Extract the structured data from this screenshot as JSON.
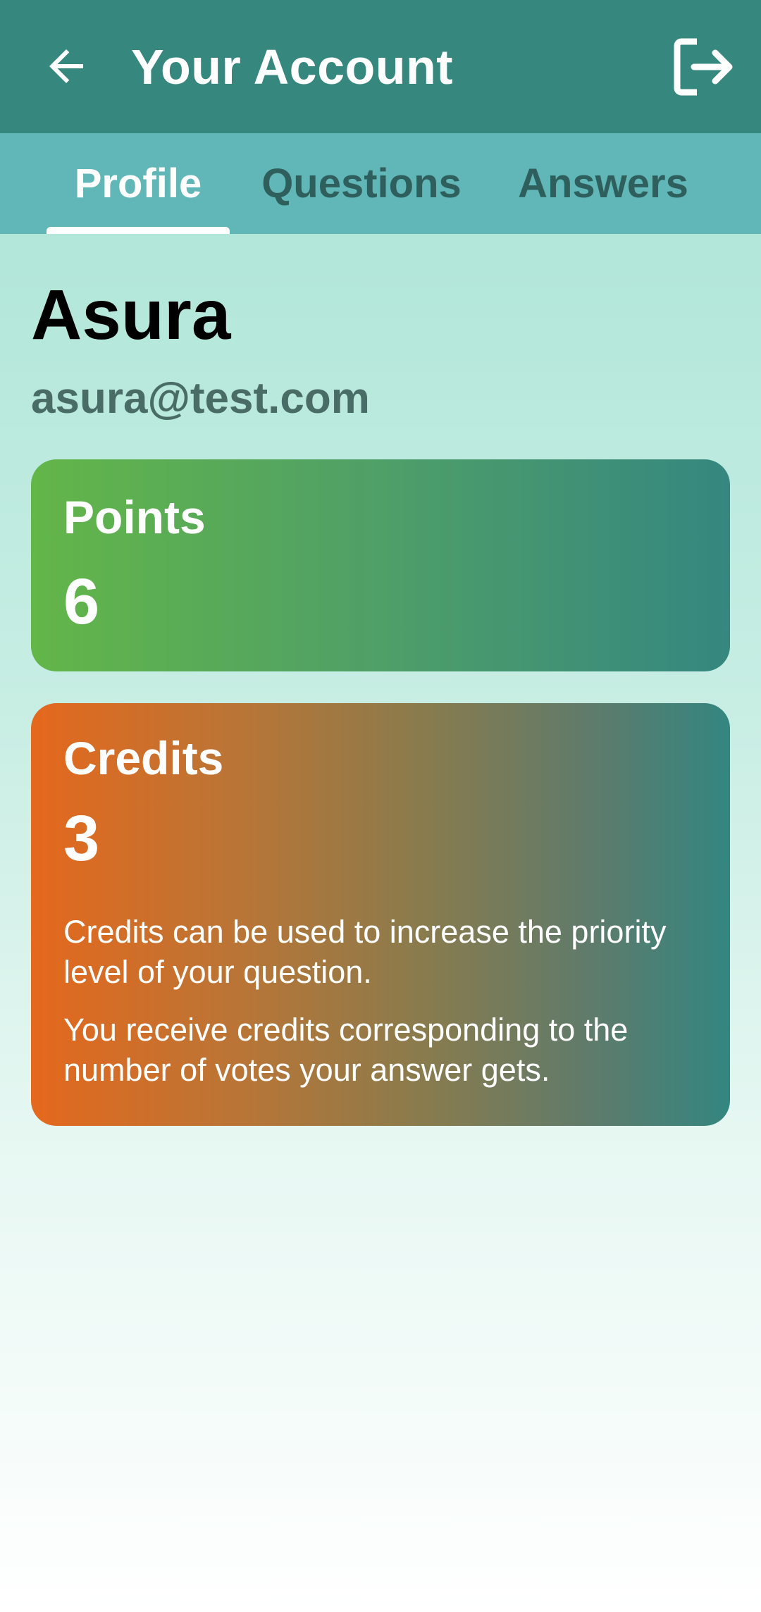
{
  "app_bar": {
    "title": "Your Account",
    "back_icon": "arrow-left-icon",
    "logout_icon": "logout-icon",
    "color": "#36877e"
  },
  "tabs": [
    {
      "label": "Profile",
      "active": true
    },
    {
      "label": "Questions",
      "active": false
    },
    {
      "label": "Answers",
      "active": false
    }
  ],
  "profile": {
    "name": "Asura",
    "email": "asura@test.com"
  },
  "points": {
    "label": "Points",
    "value": "6"
  },
  "credits": {
    "label": "Credits",
    "value": "3",
    "description": [
      "Credits can be used to increase the priority level of your question.",
      "You receive credits corresponding to the number of votes your answer gets."
    ]
  }
}
